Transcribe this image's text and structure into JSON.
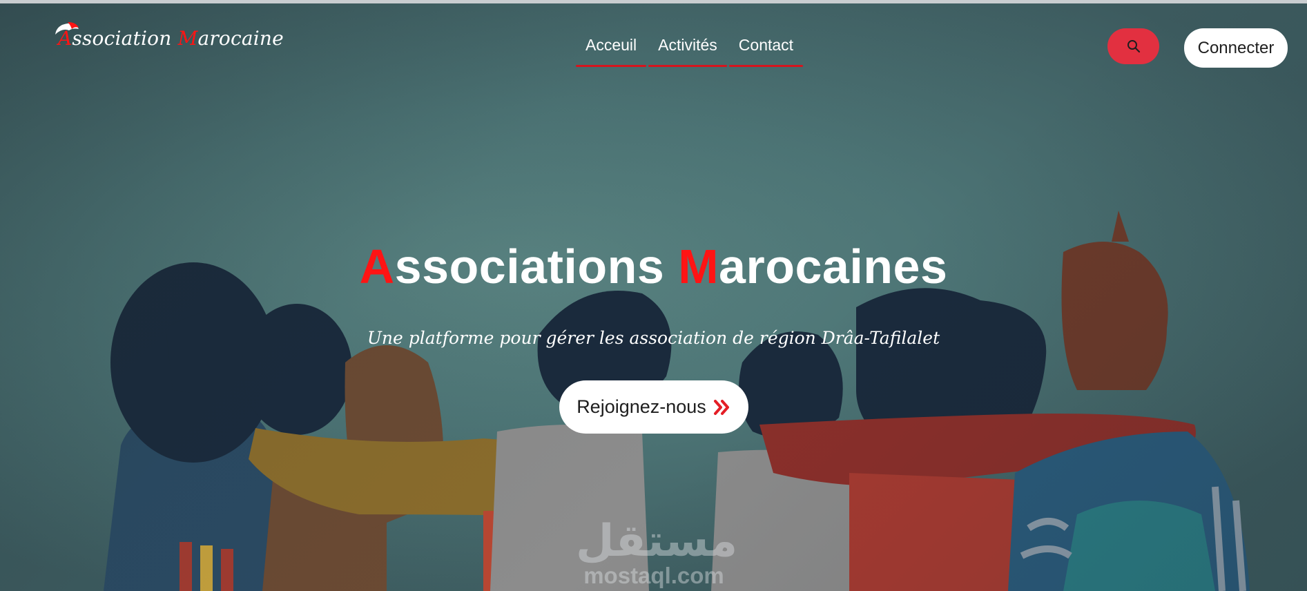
{
  "header": {
    "logo": {
      "first_letter": "A",
      "word1_rest": "ssociation",
      "second_letter": "M",
      "word2_rest": "arocaine"
    },
    "nav": [
      {
        "label": "Acceuil"
      },
      {
        "label": "Activités"
      },
      {
        "label": "Contact"
      }
    ],
    "search_icon": "search-icon",
    "connect_label": "Connecter"
  },
  "hero": {
    "title": {
      "first_letter": "A",
      "word1_rest": "ssociations",
      "second_letter": "M",
      "word2_rest": "arocaines"
    },
    "subtitle": "Une platforme pour gérer les association de région Drâa-Tafilalet",
    "cta_label": "Rejoignez-nous",
    "cta_icon": "double-chevron-right-icon"
  },
  "watermark": {
    "arabic": "مستقل",
    "url": "mostaql.com"
  },
  "colors": {
    "accent_red": "#ff1414",
    "search_button": "#e23040",
    "nav_underline": "#d7141d",
    "hero_bg": "#4d7576"
  }
}
